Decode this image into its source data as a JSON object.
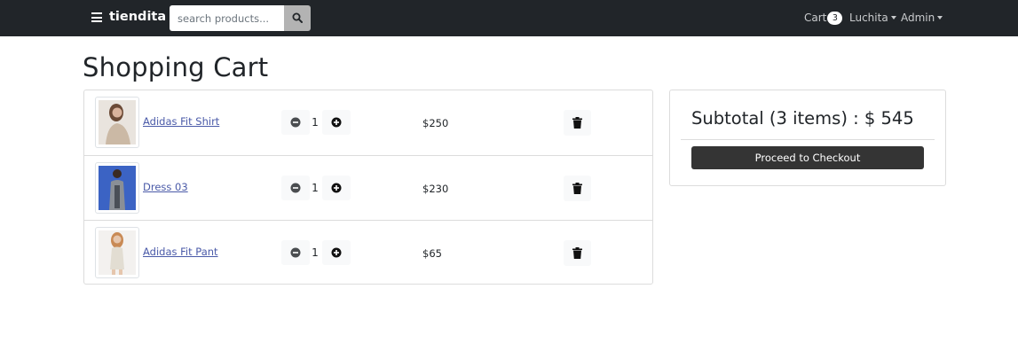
{
  "navbar": {
    "brand": "tiendita",
    "search_placeholder": "search products...",
    "cart_label": "Cart",
    "cart_count": "3",
    "user_label": "Luchita",
    "admin_label": "Admin"
  },
  "page_title": "Shopping Cart",
  "cart_items": [
    {
      "name": "Adidas Fit Shirt",
      "quantity": "1",
      "price": "$250"
    },
    {
      "name": "Dress 03",
      "quantity": "1",
      "price": "$230"
    },
    {
      "name": "Adidas Fit Pant",
      "quantity": "1",
      "price": "$65"
    }
  ],
  "summary": {
    "subtotal_text": "Subtotal (3 items) : $ 545",
    "checkout_label": "Proceed to Checkout"
  },
  "icons": {
    "menu": "bars-icon",
    "search": "search-icon",
    "decrease": "minus-circle-icon",
    "increase": "plus-circle-icon",
    "delete": "trash-icon"
  },
  "colors": {
    "navbar_bg": "#212529",
    "link": "#4a5aa8",
    "checkout_bg": "#343434"
  }
}
